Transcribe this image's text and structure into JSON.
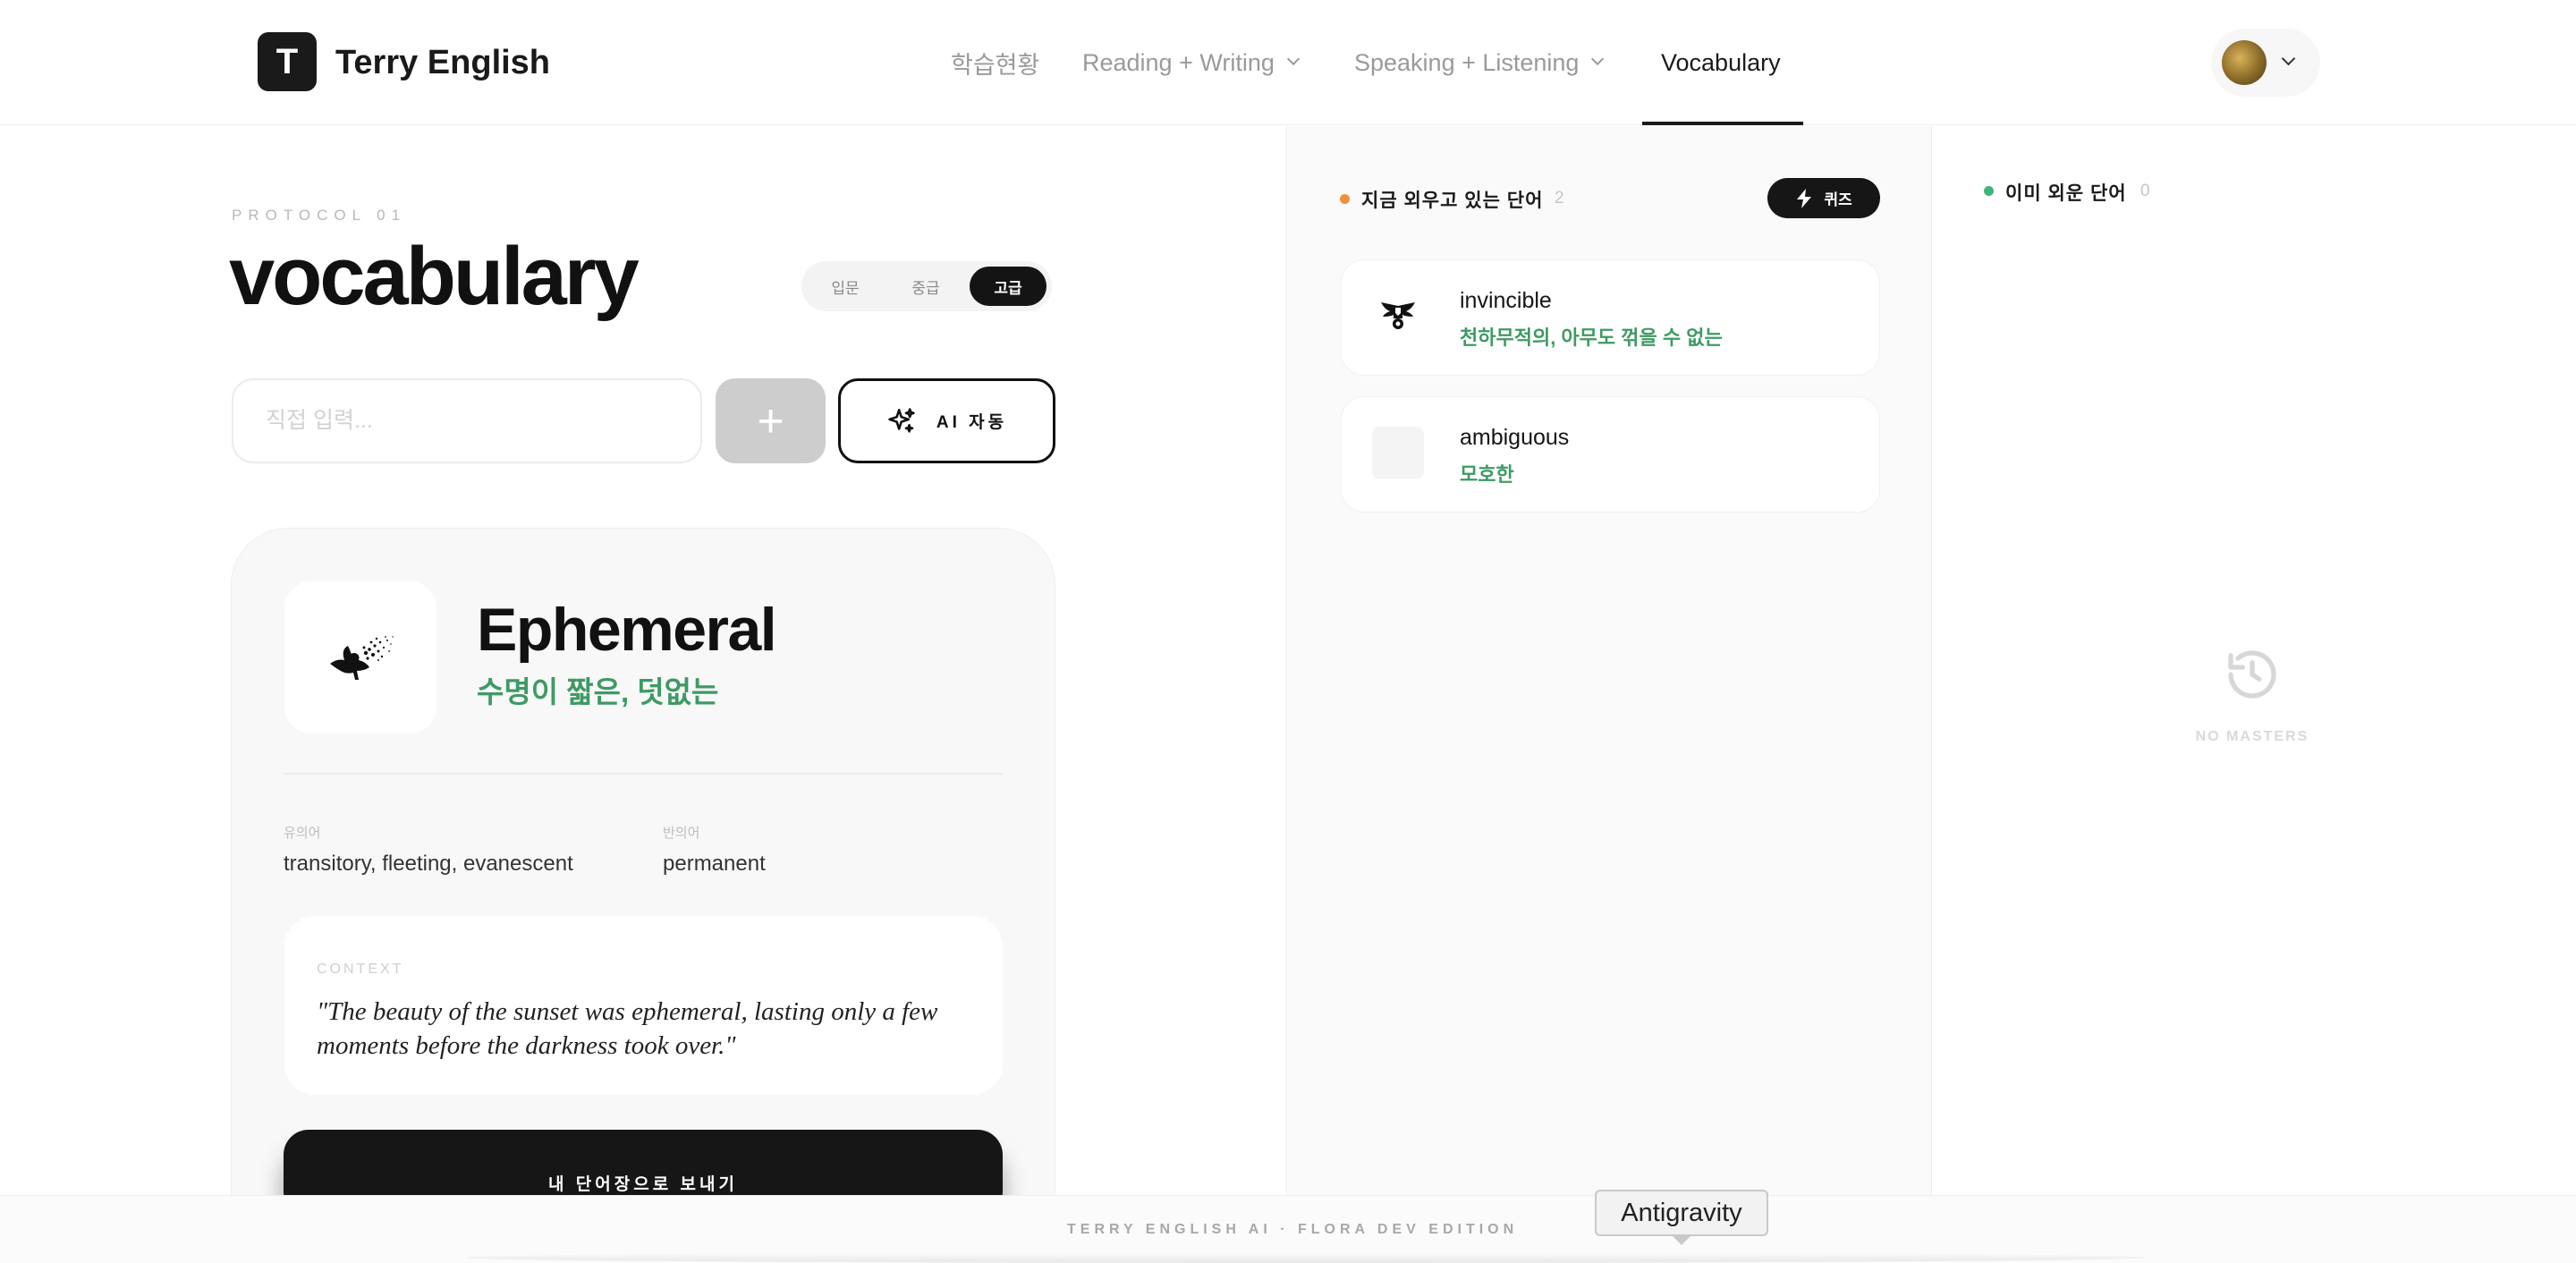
{
  "header": {
    "logo_letter": "T",
    "brand": "Terry English",
    "nav": {
      "progress": "학습현황",
      "reading_writing": "Reading + Writing",
      "speaking_listening": "Speaking + Listening",
      "vocabulary": "Vocabulary"
    },
    "active_nav": "Vocabulary"
  },
  "main": {
    "protocol": "PROTOCOL 01",
    "title": "vocabulary",
    "levels": [
      "입문",
      "중급",
      "고급"
    ],
    "selected_level": "고급",
    "input_placeholder": "직접 입력...",
    "add_label": "+",
    "ai_label": "AI 자동",
    "word_card": {
      "word": "Ephemeral",
      "meaning": "수명이 짧은, 덧없는",
      "synonyms_label": "유의어",
      "synonyms": "transitory, fleeting, evanescent",
      "antonyms_label": "반의어",
      "antonyms": "permanent",
      "context_label": "CONTEXT",
      "context": "\"The beauty of the sunset was ephemeral, lasting only a few moments before the darkness took over.\"",
      "send_label": "내 단어장으로 보내기"
    }
  },
  "learning": {
    "title": "지금 외우고 있는 단어",
    "count": "2",
    "quiz_label": "퀴즈",
    "dot_color": "#f0913a",
    "words": [
      {
        "word": "invincible",
        "meaning": "천하무적의, 아무도 꺾을 수 없는"
      },
      {
        "word": "ambiguous",
        "meaning": "모호한"
      }
    ]
  },
  "mastered": {
    "title": "이미 외운 단어",
    "count": "0",
    "dot_color": "#3fb47a",
    "empty_text": "NO MASTERS",
    "empty_icon": "history-icon"
  },
  "footer": {
    "text": "TERRY ENGLISH AI · FLORA DEV EDITION",
    "tooltip": "Antigravity"
  },
  "colors": {
    "accent_green": "#3e9a64",
    "dark": "#161616"
  }
}
